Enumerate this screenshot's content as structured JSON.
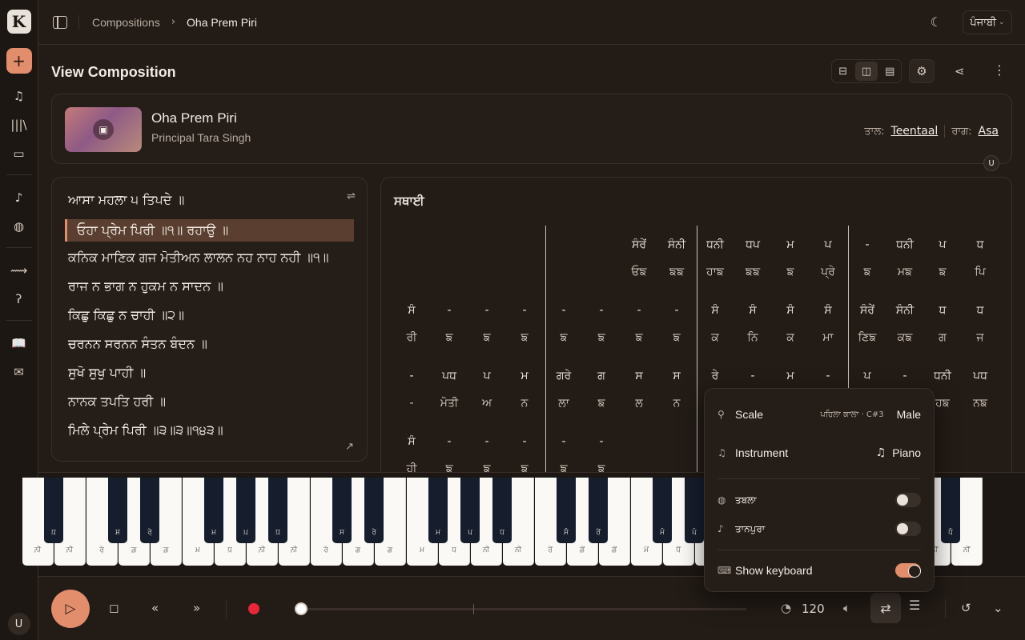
{
  "sidebar": {
    "logo": "K",
    "add": "+",
    "user_initial": "U"
  },
  "header": {
    "breadcrumb_root": "Compositions",
    "breadcrumb_current": "Oha Prem Piri",
    "language": "ਪੰਜਾਬੀ"
  },
  "page": {
    "title": "View Composition"
  },
  "composition": {
    "title": "Oha Prem Piri",
    "artist": "Principal Tara Singh",
    "taal_label": "ਤਾਲ:",
    "taal": "Teentaal",
    "raag_label": "ਰਾਗ:",
    "raag": "Asa",
    "badge": "U"
  },
  "lyrics": [
    "ਆਸਾ ਮਹਲਾ ੫ ਤਿਪਦੇ ॥",
    "ਓਹਾ ਪ੍ਰੇਮ ਪਿਰੀ ॥੧॥ ਰਹਾਉ ॥",
    "ਕਨਿਕ ਮਾਣਿਕ ਗਜ ਮੋਤੀਅਨ ਲਾਲਨ ਨਹ ਨਾਹ ਨਹੀ ॥੧॥",
    "ਰਾਜ ਨ ਭਾਗ ਨ ਹੁਕਮ ਨ ਸਾਦਨ ॥",
    "ਕਿਛੁ ਕਿਛੁ ਨ ਚਾਹੀ ॥੨॥",
    "ਚਰਨਨ ਸਰਨਨ ਸੰਤਨ ਬੰਦਨ ॥",
    "ਸੁਖੋ ਸੁਖੁ ਪਾਹੀ ॥",
    "ਨਾਨਕ ਤਪਤਿ ਹਰੀ ॥",
    "ਮਿਲੇ ਪ੍ਰੇਮ ਪਿਰੀ ॥੩॥੩॥੧੪੩॥"
  ],
  "notation": {
    "section": "ਸਥਾਈ",
    "rows": [
      {
        "swar": [
          "",
          "",
          "",
          "",
          "",
          "",
          "ਸੰਰੇਂ",
          "ਸੰਨੀ",
          "ਧਨੀ",
          "ਧਪ",
          "ਮ",
          "ਪ",
          "-",
          "ਧਨੀ",
          "ਪ",
          "ਧ"
        ],
        "bol": [
          "",
          "",
          "",
          "",
          "",
          "",
          "ਓਙ",
          "ਙਙ",
          "ਹਾਙ",
          "ਙਙ",
          "ਙ",
          "ਪ੍ਰੇ",
          "ਙ",
          "ਮਙ",
          "ਙ",
          "ਪਿ"
        ]
      },
      {
        "swar": [
          "ਸੰ",
          "-",
          "-",
          "-",
          "-",
          "-",
          "-",
          "-",
          "ਸੰ",
          "ਸੰ",
          "ਸੰ",
          "ਸੰ",
          "ਸੰਰੇਂ",
          "ਸੰਨੀ",
          "ਧ",
          "ਧ"
        ],
        "bol": [
          "ਰੀ",
          "ਙ",
          "ਙ",
          "ਙ",
          "ਙ",
          "ਙ",
          "ਙ",
          "ਙ",
          "ਕ",
          "ਨਿ",
          "ਕ",
          "ਮਾ",
          "ਣਿਙ",
          "ਕਙ",
          "ਗ",
          "ਜ"
        ]
      },
      {
        "swar": [
          "-",
          "ਪਧ",
          "ਪ",
          "ਮ",
          "ਗਰੇ",
          "ਗ",
          "ਸ",
          "ਸ",
          "ਰੇ",
          "-",
          "ਮ",
          "-",
          "ਪ",
          "-",
          "ਧਨੀ",
          "ਪਧ"
        ],
        "bol": [
          "-",
          "ਮੋਤੀ",
          "ਅ",
          "ਨ",
          "ਲਾ",
          "ਙ",
          "ਲ",
          "ਨ",
          "",
          "",
          "",
          "",
          "",
          "",
          "ਹਙ",
          "ਨਙ"
        ]
      },
      {
        "swar": [
          "ਸੰ",
          "-",
          "-",
          "-",
          "-",
          "-"
        ],
        "bol": [
          "ਹੀ",
          "ਙ",
          "ਙ",
          "ਙ",
          "ਙ",
          "ਙ"
        ]
      }
    ]
  },
  "keyboard": {
    "white_labels": [
      "ਨ਼ੀ",
      "ਨ਼ੀ",
      "ਰੇ਼",
      "ਗ਼",
      "ਗ਼",
      "ਮ਼",
      "ਧ਼",
      "ਨ਼ੀ",
      "ਨ਼ੀ",
      "ਰੇ",
      "ਗ",
      "ਗ",
      "ਮ",
      "ਧ",
      "ਨੀ",
      "ਨੀ",
      "ਰੇਂ",
      "ਗੇਂ",
      "ਗੇਂ",
      "ਮੇਂ",
      "ਧੇਂ",
      "ਨੀਂ",
      "ਨੀਂ",
      "ਰੇਂ",
      "ਗੇਂ",
      "ਗੇਂ",
      "ਮੇਂ",
      "ਧੇਂ",
      "ਨੀਂ",
      "ਨੀਂ"
    ],
    "black_labels": [
      "ਧ਼",
      "ਸ਼",
      "ਰੇ਼",
      "ਮ਼",
      "ਪ਼",
      "ਧ਼",
      "ਸ",
      "ਰੇ",
      "ਮ",
      "ਪ",
      "ਧ",
      "ਸੰ",
      "ਰੇਂ",
      "ਮੰ",
      "ਪੰ",
      "ਧੰ"
    ]
  },
  "settings": {
    "scale_label": "Scale",
    "scale_sub": "ਪਹਿਲਾ ਕਾਲਾ · C#3",
    "scale_value": "Male",
    "instrument_label": "Instrument",
    "instrument_value": "Piano",
    "tabla_label": "ਤਬਲਾ",
    "tanpura_label": "ਤਾਨਪੁਰਾ",
    "keyboard_label": "Show keyboard",
    "tabla_on": false,
    "tanpura_on": false,
    "keyboard_on": true
  },
  "playback": {
    "tempo": "120",
    "progress": 0
  },
  "colors": {
    "accent": "#e28d6c",
    "record": "#e8283a",
    "background": "#221b16"
  }
}
